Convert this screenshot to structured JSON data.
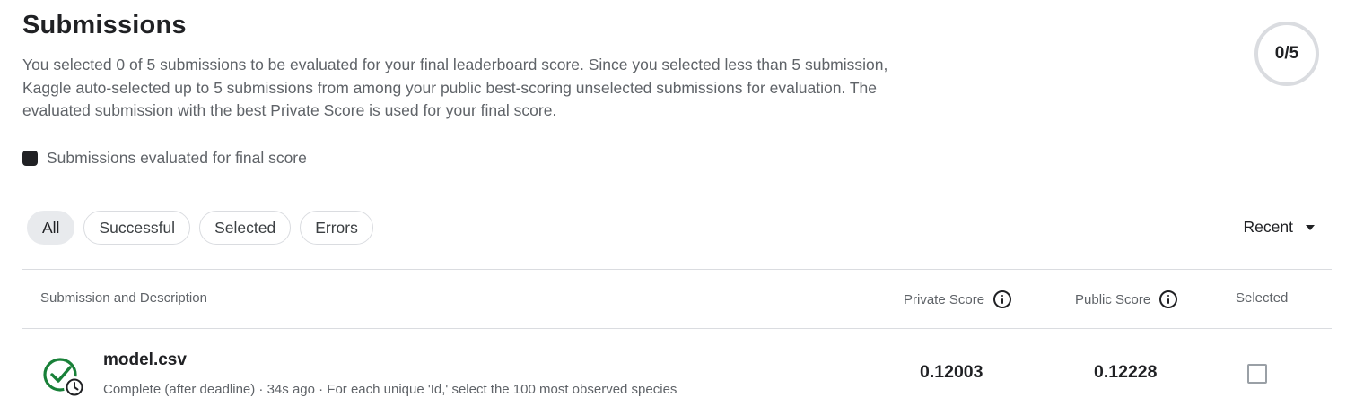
{
  "page": {
    "title": "Submissions",
    "description": "You selected 0 of 5 submissions to be evaluated for your final leaderboard score. Since you selected less than 5 submission, Kaggle auto-selected up to 5 submissions from among your public best-scoring unselected submissions for evaluation. The evaluated submission with the best Private Score is used for your final score.",
    "selection_counter": "0/5"
  },
  "legend": {
    "label": "Submissions evaluated for final score"
  },
  "filters": [
    {
      "label": "All",
      "active": true
    },
    {
      "label": "Successful",
      "active": false
    },
    {
      "label": "Selected",
      "active": false
    },
    {
      "label": "Errors",
      "active": false
    }
  ],
  "sort": {
    "label": "Recent"
  },
  "table": {
    "headers": {
      "submission": "Submission and Description",
      "private_score": "Private Score",
      "public_score": "Public Score",
      "selected": "Selected"
    },
    "rows": [
      {
        "file_name": "model.csv",
        "meta": "Complete (after deadline) · 34s ago · For each unique 'Id,' select the 100 most observed species",
        "private_score": "0.12003",
        "public_score": "0.12228",
        "selected": false
      }
    ]
  },
  "colors": {
    "success_green": "#188038",
    "text_primary": "#202124",
    "text_secondary": "#5f6368",
    "border": "#dadce0"
  },
  "icons": {
    "status": "check-clock-icon",
    "info": "info-icon",
    "sort_caret": "caret-down-icon"
  }
}
